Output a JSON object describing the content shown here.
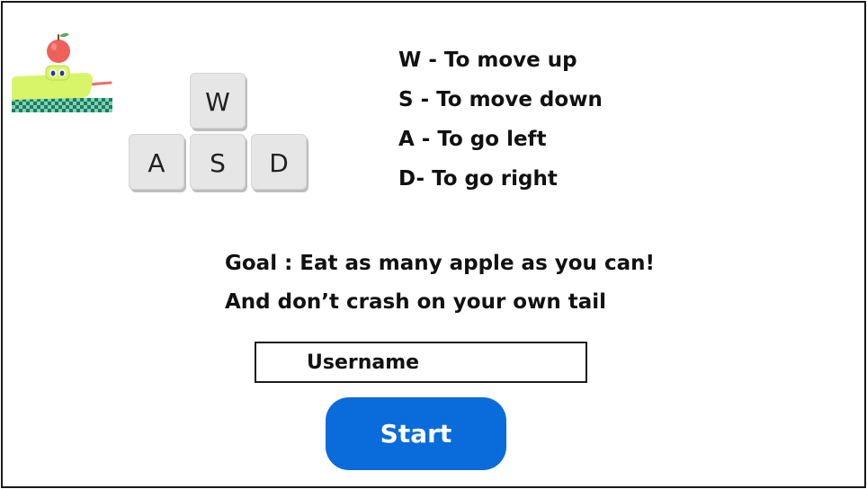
{
  "keys": {
    "up": "W",
    "left": "A",
    "down": "S",
    "right": "D"
  },
  "instructions": [
    "W - To move up",
    "S - To move down",
    "A - To go left",
    "D- To go right"
  ],
  "goal": {
    "line1": "Goal : Eat as many apple as you can!",
    "line2": "And don’t crash on your own tail"
  },
  "username": {
    "placeholder": "Username",
    "value": ""
  },
  "start_button_label": "Start",
  "icons": {
    "logo": "snake-with-apple-icon"
  },
  "colors": {
    "accent": "#0a6bdb",
    "snake": "#d8f56a",
    "apple": "#f0605a",
    "checker_dark": "#1f7a66",
    "checker_light": "#7fd3b0"
  }
}
